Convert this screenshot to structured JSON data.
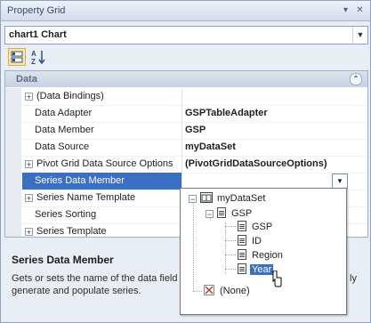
{
  "window": {
    "title": "Property Grid"
  },
  "object_selector": {
    "value": "chart1  Chart"
  },
  "toolbar": {
    "categorized_label": "Categorized",
    "alphabetical_label": "Alphabetical"
  },
  "category": {
    "label": "Data"
  },
  "rows": [
    {
      "name": "(Data Bindings)",
      "value": "",
      "expandable": true
    },
    {
      "name": "Data Adapter",
      "value": "GSPTableAdapter",
      "expandable": false
    },
    {
      "name": "Data Member",
      "value": "GSP",
      "expandable": false
    },
    {
      "name": "Data Source",
      "value": "myDataSet",
      "expandable": false
    },
    {
      "name": "Pivot Grid Data Source Options",
      "value": "(PivotGridDataSourceOptions)",
      "expandable": true
    },
    {
      "name": "Series Data Member",
      "value": "",
      "expandable": false,
      "selected": true
    },
    {
      "name": "Series Name Template",
      "value": "",
      "expandable": true
    },
    {
      "name": "Series Sorting",
      "value": "",
      "expandable": false
    },
    {
      "name": "Series Template",
      "value": "",
      "expandable": true
    }
  ],
  "description": {
    "title": "Series Data Member",
    "text_line1": "Gets or sets the name of the data field",
    "text_line1_tail": "ly",
    "text_line2": "generate and populate series."
  },
  "dropdown_tree": {
    "dataset": "myDataSet",
    "table": "GSP",
    "fields": [
      "GSP",
      "ID",
      "Region",
      "Year"
    ],
    "selected_field": "Year",
    "none_label": "(None)"
  }
}
